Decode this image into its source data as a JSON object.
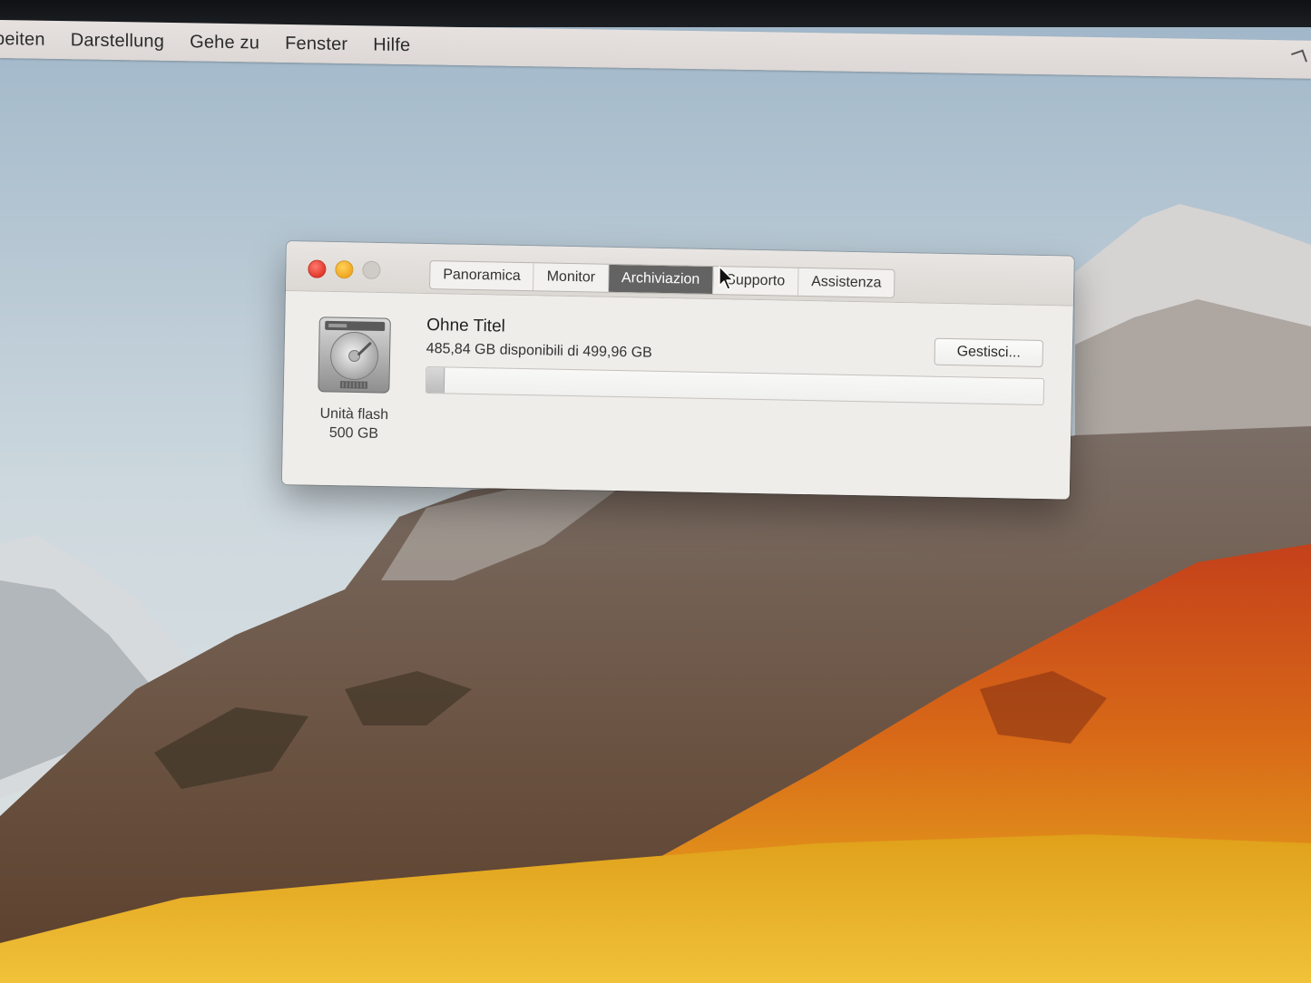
{
  "menubar": {
    "items": [
      "beiten",
      "Darstellung",
      "Gehe zu",
      "Fenster",
      "Hilfe"
    ]
  },
  "window": {
    "tabs": [
      {
        "label": "Panoramica",
        "active": false
      },
      {
        "label": "Monitor",
        "active": false
      },
      {
        "label": "Archiviazion",
        "active": true
      },
      {
        "label": "Supporto",
        "active": false
      },
      {
        "label": "Assistenza",
        "active": false
      }
    ],
    "drive": {
      "icon": "hard-drive-icon",
      "label_line1": "Unità flash",
      "label_line2": "500 GB"
    },
    "volume": {
      "name": "Ohne Titel",
      "availability": "485,84 GB disponibili di 499,96 GB",
      "used_fraction": 0.028
    },
    "manage_button": "Gestisci..."
  },
  "colors": {
    "close": "#e3392d",
    "minimize": "#f1a722",
    "active_tab": "#636363"
  }
}
